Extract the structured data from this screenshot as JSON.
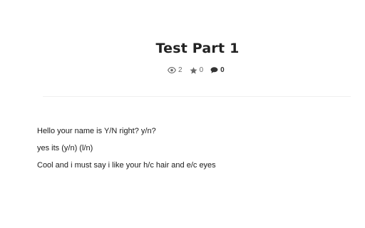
{
  "header": {
    "title": "Test Part 1"
  },
  "stats": {
    "views": {
      "icon": "eye-icon",
      "count": "2"
    },
    "votes": {
      "icon": "star-icon",
      "count": "0"
    },
    "comments": {
      "icon": "comment-icon",
      "count": "0"
    }
  },
  "story": {
    "paragraphs": [
      "Hello your name is Y/N right? y/n?",
      "yes its (y/n) (l/n)",
      "Cool and i must say i like your h/c hair and e/c eyes"
    ]
  },
  "colors": {
    "text": "#222222",
    "meta": "#6b6b6b",
    "divider": "#efefef"
  }
}
